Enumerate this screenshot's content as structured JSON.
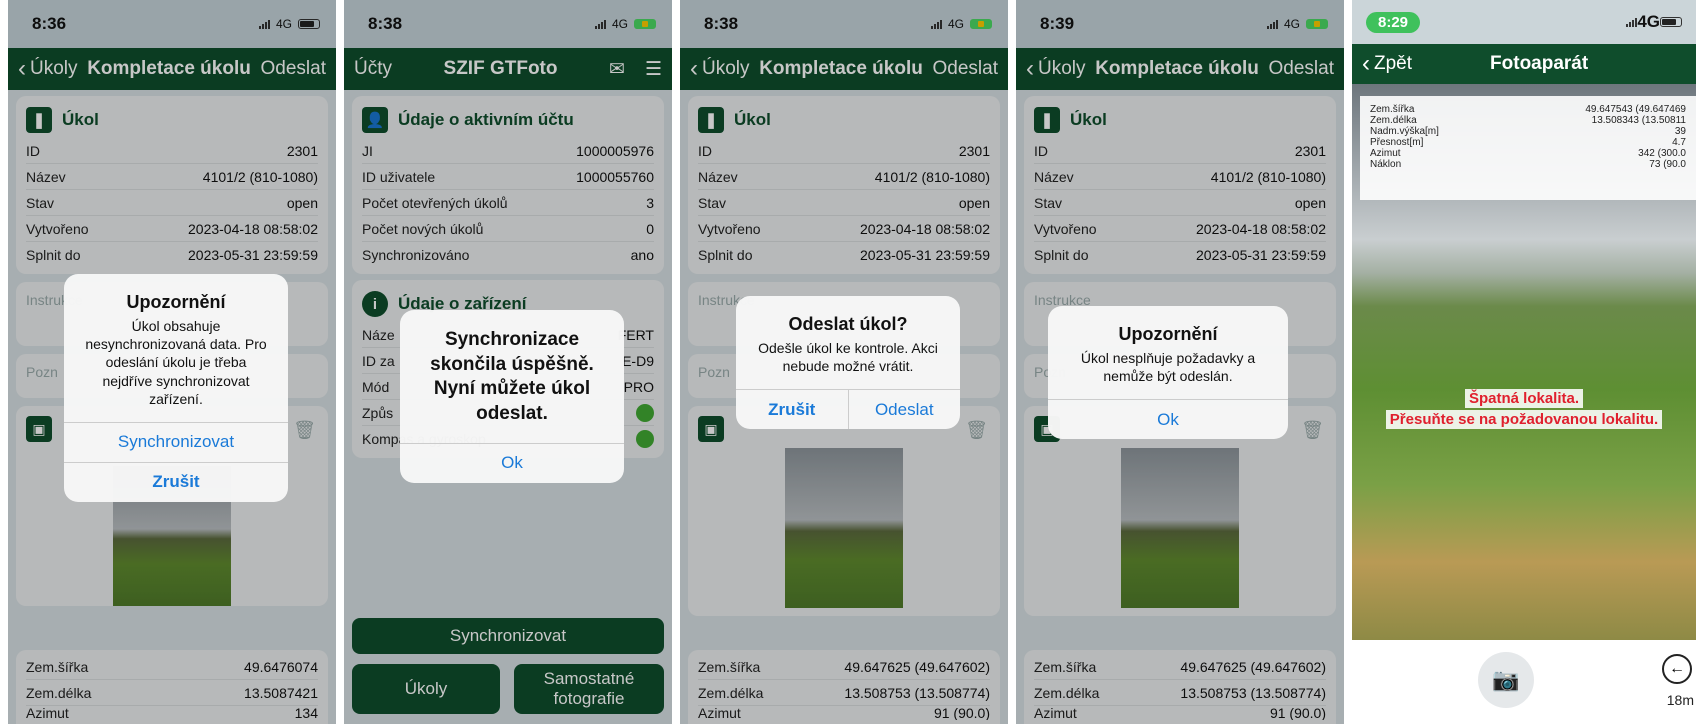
{
  "status": {
    "p1_time": "8:36",
    "p2_time": "8:38",
    "p3_time": "8:38",
    "p4_time": "8:39",
    "p5_time": "8:29",
    "network": "4G"
  },
  "task_nav": {
    "back": "Úkoly",
    "title": "Kompletace úkolu",
    "send": "Odeslat"
  },
  "task_card": {
    "title": "Úkol",
    "rows": [
      {
        "label": "ID",
        "value": "2301"
      },
      {
        "label": "Název",
        "value": "4101/2 (810-1080)"
      },
      {
        "label": "Stav",
        "value": "open"
      },
      {
        "label": "Vytvořeno",
        "value": "2023-04-18 08:58:02"
      },
      {
        "label": "Splnit do",
        "value": "2023-05-31 23:59:59"
      }
    ]
  },
  "instr_placeholder": "Instrukce",
  "note_placeholder": "Pozn",
  "p1_geo": [
    {
      "label": "Zem.šířka",
      "value": "49.6476074"
    },
    {
      "label": "Zem.délka",
      "value": "13.5087421"
    },
    {
      "label": "Azimut",
      "value": "134"
    }
  ],
  "p34_geo": [
    {
      "label": "Zem.šířka",
      "value": "49.647625 (49.647602)"
    },
    {
      "label": "Zem.délka",
      "value": "13.508753 (13.508774)"
    },
    {
      "label": "Azimut",
      "value": "91 (90.0)"
    }
  ],
  "dialog1": {
    "title": "Upozornění",
    "message": "Úkol obsahuje nesynchronizovaná data. Pro odeslání úkolu je třeba nejdříve synchronizovat zařízení.",
    "btn_sync": "Synchronizovat",
    "btn_cancel": "Zrušit"
  },
  "p2": {
    "nav_left": "Účty",
    "nav_title": "SZIF GTFoto",
    "account_title": "Údaje o aktivním účtu",
    "account_rows": [
      {
        "label": "JI",
        "value": "1000005976"
      },
      {
        "label": "ID uživatele",
        "value": "1000055760"
      },
      {
        "label": "Počet otevřených úkolů",
        "value": "3"
      },
      {
        "label": "Počet nových úkolů",
        "value": "0"
      },
      {
        "label": "Synchronizováno",
        "value": "ano"
      }
    ],
    "device_title": "Údaje o zařízení",
    "device_rows": [
      {
        "label": "Náze",
        "value": "FERT"
      },
      {
        "label": "ID za",
        "value": "E-D9"
      },
      {
        "label": "Mód",
        "value": "PRO"
      },
      {
        "label": "Způs",
        "value": ""
      },
      {
        "label": "Kompas a gyroskop",
        "value": ""
      }
    ],
    "dialog_message": "Synchronizace skončila úspěšně. Nyní můžete úkol odeslat.",
    "dialog_ok": "Ok",
    "btn_sync": "Synchronizovat",
    "btn_tasks": "Úkoly",
    "btn_photos": "Samostatné fotografie"
  },
  "dialog3": {
    "title": "Odeslat úkol?",
    "message": "Odešle úkol ke kontrole. Akci nebude možné vrátit.",
    "btn_cancel": "Zrušit",
    "btn_send": "Odeslat"
  },
  "dialog4": {
    "title": "Upozornění",
    "message": "Úkol nesplňuje požadavky a nemůže být odeslán.",
    "btn_ok": "Ok"
  },
  "p5": {
    "back": "Zpět",
    "title": "Fotoaparát",
    "info": [
      {
        "label": "Zem.šířka",
        "value": "49.647543 (49.647469"
      },
      {
        "label": "Zem.délka",
        "value": "13.508343 (13.50811"
      },
      {
        "label": "Nadm.výška[m]",
        "value": "39"
      },
      {
        "label": "Přesnost[m]",
        "value": "4.7"
      },
      {
        "label": "Azimut",
        "value": "342 (300.0"
      },
      {
        "label": "Náklon",
        "value": "73 (90.0"
      }
    ],
    "warn_line1": "Špatná lokalita.",
    "warn_line2": "Přesuňte se na požadovanou lokalitu.",
    "distance": "18m"
  },
  "colors": {
    "brand": "#0f4d2c",
    "link": "#1a7ad8",
    "warning": "#e0202e",
    "ok": "#41a833"
  }
}
